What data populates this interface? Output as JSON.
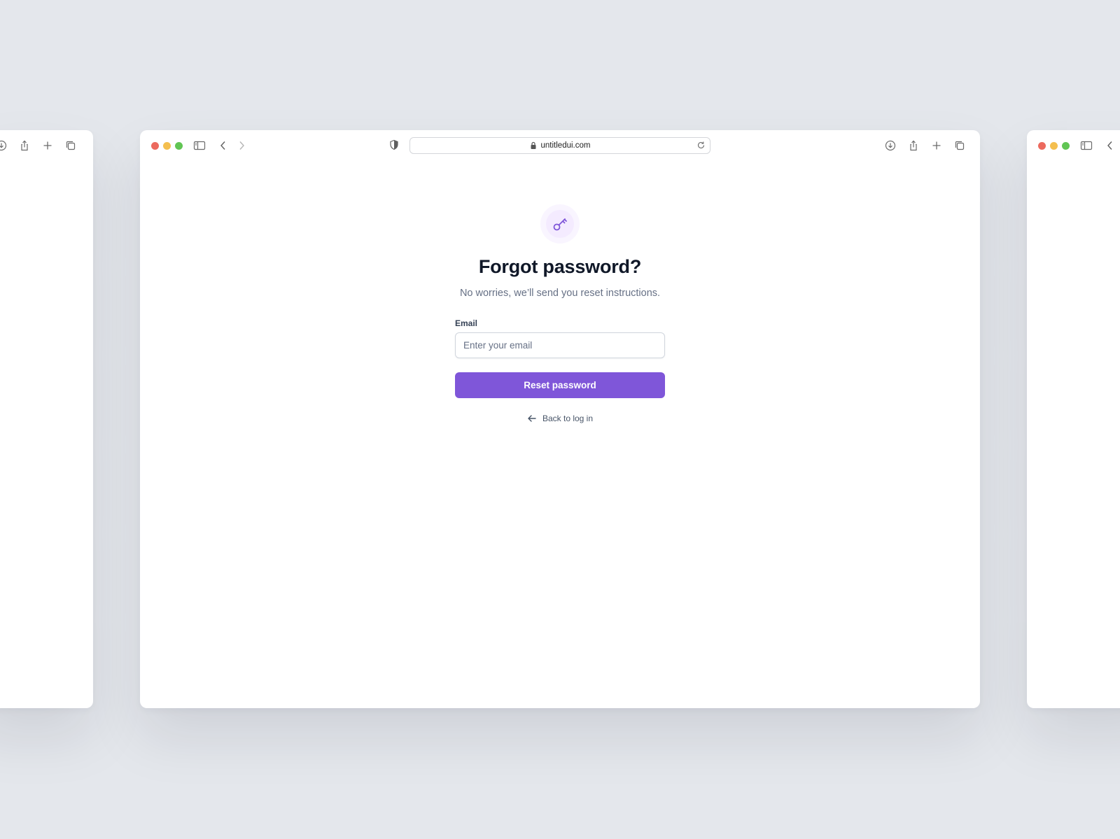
{
  "browser": {
    "url": "untitledui.com",
    "icons": {
      "lock": "lock-icon",
      "reload": "reload-icon",
      "shield": "privacy-shield-icon",
      "sidebar": "sidebar-icon",
      "back": "chevron-left-icon",
      "forward": "chevron-right-icon",
      "download": "download-icon",
      "share": "share-icon",
      "new_tab": "plus-icon",
      "tabs": "tab-overview-icon"
    },
    "traffic_lights": {
      "close": "#ec6a5e",
      "minimize": "#f4bf4f",
      "zoom": "#61c554"
    }
  },
  "page": {
    "icon": "key-icon",
    "title": "Forgot password?",
    "subtitle": "No worries, we’ll send you reset instructions.",
    "email_label": "Email",
    "email_placeholder": "Enter your email",
    "email_value": "",
    "submit_label": "Reset password",
    "back_label": "Back to log in",
    "back_icon": "arrow-left-icon"
  },
  "colors": {
    "brand": "#7f56d9",
    "brand_light": "#f4ebff",
    "heading": "#101828",
    "muted": "#667085",
    "background": "#e4e7ec"
  }
}
